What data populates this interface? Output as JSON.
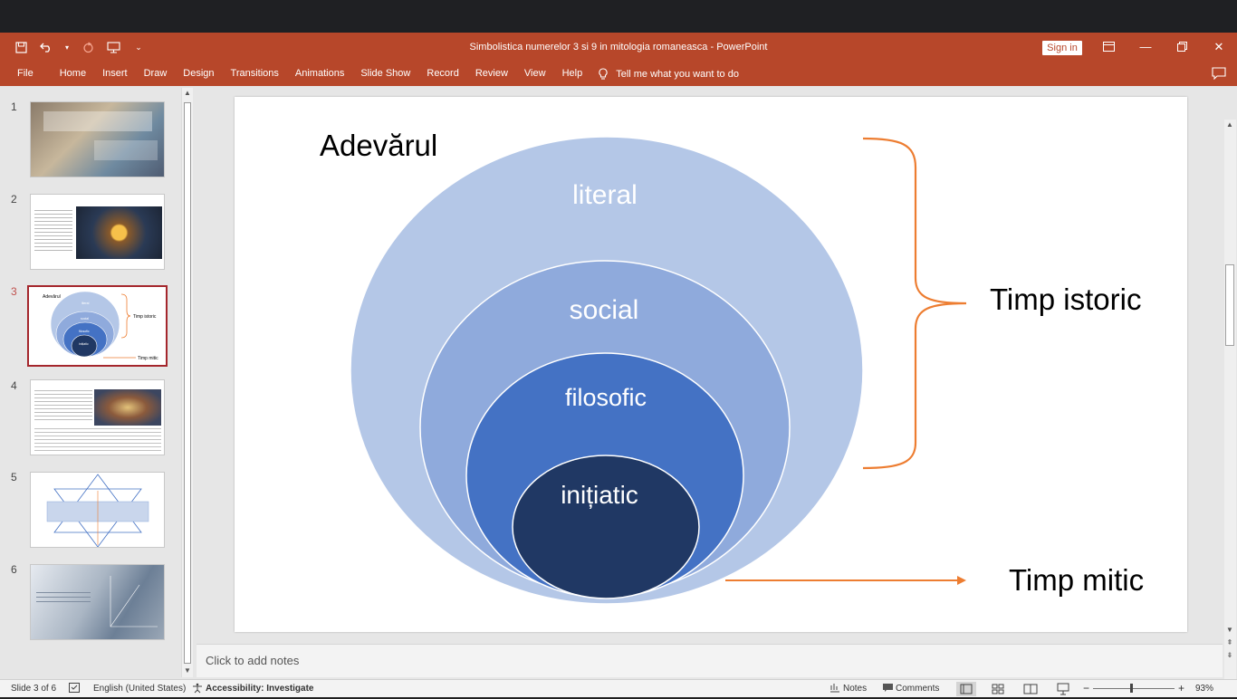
{
  "window": {
    "title": "Simbolistica numerelor 3 si 9 in mitologia romaneasca  -  PowerPoint",
    "sign_in": "Sign in"
  },
  "ribbon": {
    "tabs": [
      "File",
      "Home",
      "Insert",
      "Draw",
      "Design",
      "Transitions",
      "Animations",
      "Slide Show",
      "Record",
      "Review",
      "View",
      "Help"
    ],
    "tell_me": "Tell me what you want to do"
  },
  "thumbnails": {
    "numbers": [
      "1",
      "2",
      "3",
      "4",
      "5",
      "6"
    ],
    "active": "3",
    "slide3_mini": {
      "title": "Adevărul",
      "rings": [
        "literal",
        "social",
        "filosofic",
        "inițiatic"
      ],
      "right_top": "Timp istoric",
      "right_bottom": "Timp mitic"
    }
  },
  "slide": {
    "title": "Adevărul",
    "rings": {
      "outer": "literal",
      "second": "social",
      "third": "filosofic",
      "inner": "inițiatic"
    },
    "right_top": "Timp istoric",
    "right_bottom": "Timp mitic",
    "colors": {
      "outer": "#b4c7e7",
      "second": "#8faadc",
      "third": "#4472c4",
      "inner": "#203864",
      "arrow": "#ed7d31"
    }
  },
  "notes": {
    "placeholder": "Click to add notes"
  },
  "status": {
    "slide_of": "Slide 3 of 6",
    "language": "English (United States)",
    "accessibility": "Accessibility: Investigate",
    "notes": "Notes",
    "comments": "Comments",
    "zoom": "93%"
  }
}
